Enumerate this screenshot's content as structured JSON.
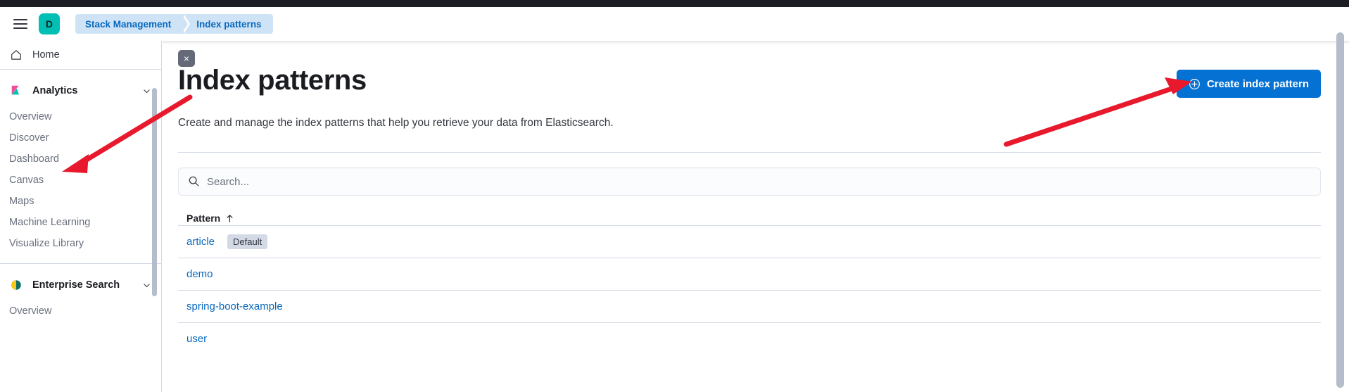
{
  "header": {
    "menu_icon": "hamburger-menu-icon",
    "avatar_label": "D",
    "breadcrumbs": [
      {
        "label": "Stack Management"
      },
      {
        "label": "Index patterns"
      }
    ]
  },
  "sidebar": {
    "home": {
      "label": "Home",
      "icon": "home-icon"
    },
    "groups": [
      {
        "title": "Analytics",
        "icon": "kibana-analytics-icon",
        "chevron": "chevron-down-icon",
        "items": [
          {
            "label": "Overview"
          },
          {
            "label": "Discover"
          },
          {
            "label": "Dashboard"
          },
          {
            "label": "Canvas"
          },
          {
            "label": "Maps"
          },
          {
            "label": "Machine Learning"
          },
          {
            "label": "Visualize Library"
          }
        ]
      },
      {
        "title": "Enterprise Search",
        "icon": "enterprise-search-icon",
        "chevron": "chevron-down-icon",
        "items": [
          {
            "label": "Overview"
          }
        ]
      }
    ]
  },
  "main": {
    "close_label": "×",
    "title": "Index patterns",
    "create_button": "Create index pattern",
    "create_icon": "plus-circle-icon",
    "description": "Create and manage the index patterns that help you retrieve your data from Elasticsearch.",
    "search": {
      "value": "",
      "placeholder": "Search...",
      "icon": "search-icon"
    },
    "table": {
      "columns": [
        {
          "label": "Pattern",
          "sort": "ascending",
          "sort_icon": "arrow-up-icon"
        }
      ],
      "rows": [
        {
          "pattern": "article",
          "badge": "Default"
        },
        {
          "pattern": "demo",
          "badge": ""
        },
        {
          "pattern": "spring-boot-example",
          "badge": ""
        },
        {
          "pattern": "user",
          "badge": ""
        }
      ]
    }
  },
  "colors": {
    "accent_blue": "#0571d3",
    "link_blue": "#0869be",
    "breadcrumb_bg": "#cfe3f7",
    "avatar_teal": "#00bfb3",
    "annotation_red": "#e8192c",
    "topbar_dark": "#1d1e24",
    "border": "#d3dae6"
  }
}
